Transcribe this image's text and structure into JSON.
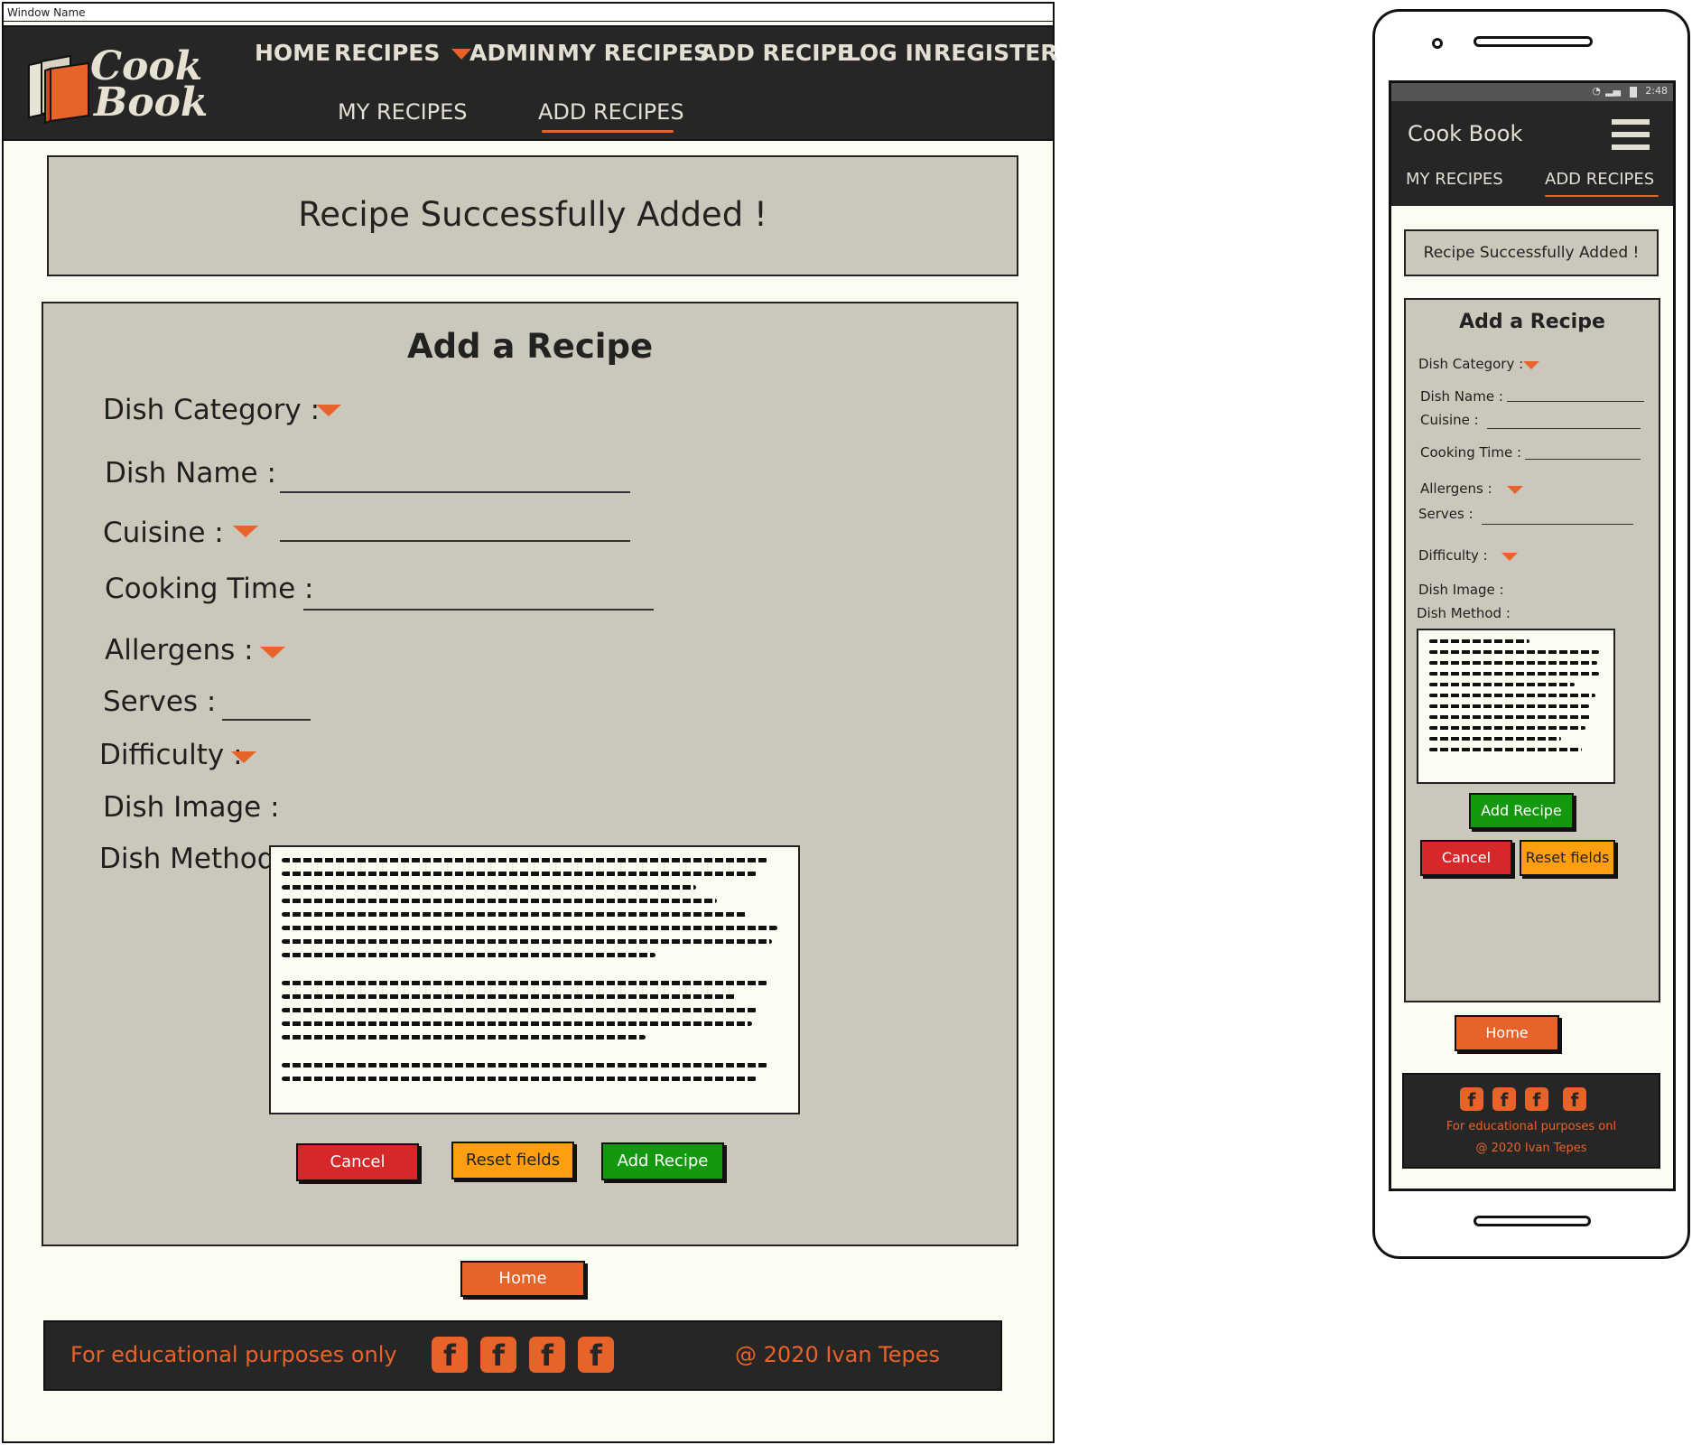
{
  "desktop": {
    "window_title": "Window Name",
    "logo": {
      "line1": "Cook",
      "line2": "Book"
    },
    "nav": {
      "home": "HOME",
      "recipes": "RECIPES",
      "admin": "ADMIN",
      "my_recipes": "MY RECIPES",
      "add_recipe": "ADD RECIPE",
      "log_in": "LOG IN",
      "register": "REGISTER"
    },
    "subnav": {
      "my_recipes": "MY RECIPES",
      "add_recipes": "ADD RECIPES"
    },
    "message": "Recipe Successfully Added !",
    "form": {
      "title": "Add a Recipe",
      "dish_category": "Dish Category :",
      "dish_name": "Dish Name :",
      "cuisine": "Cuisine :",
      "cooking_time": "Cooking Time :",
      "allergens": "Allergens :",
      "serves": "Serves :",
      "difficulty": "Difficulty :",
      "dish_image": "Dish Image :",
      "dish_method": "Dish Method"
    },
    "buttons": {
      "cancel": "Cancel",
      "reset": "Reset fields",
      "add": "Add Recipe",
      "home": "Home"
    },
    "footer": {
      "left": "For educational purposes only",
      "right": "@ 2020 Ivan Tepes"
    }
  },
  "mobile": {
    "status_time": "2:48",
    "brand": "Cook Book",
    "subnav": {
      "my_recipes": "MY RECIPES",
      "add_recipes": "ADD RECIPES"
    },
    "message": "Recipe Successfully Added !",
    "form": {
      "title": "Add a Recipe",
      "dish_category": "Dish Category :",
      "dish_name": "Dish Name :",
      "cuisine": "Cuisine :",
      "cooking_time": "Cooking Time :",
      "allergens": "Allergens :",
      "serves": "Serves :",
      "difficulty": "Difficulty :",
      "dish_image": "Dish Image :",
      "dish_method": "Dish Method :"
    },
    "buttons": {
      "add": "Add Recipe",
      "cancel": "Cancel",
      "reset": "Reset fields",
      "home": "Home"
    },
    "footer": {
      "line1": "For educational purposes onl",
      "line2": "@ 2020 Ivan Tepes"
    }
  },
  "colors": {
    "accent": "#e8632a",
    "nav_bg": "#262626",
    "panel_bg": "#cbc7bb",
    "page_bg": "#fdfcf3"
  },
  "icons": [
    "facebook-icon",
    "caret-down-icon",
    "hamburger-icon",
    "book-icon"
  ]
}
